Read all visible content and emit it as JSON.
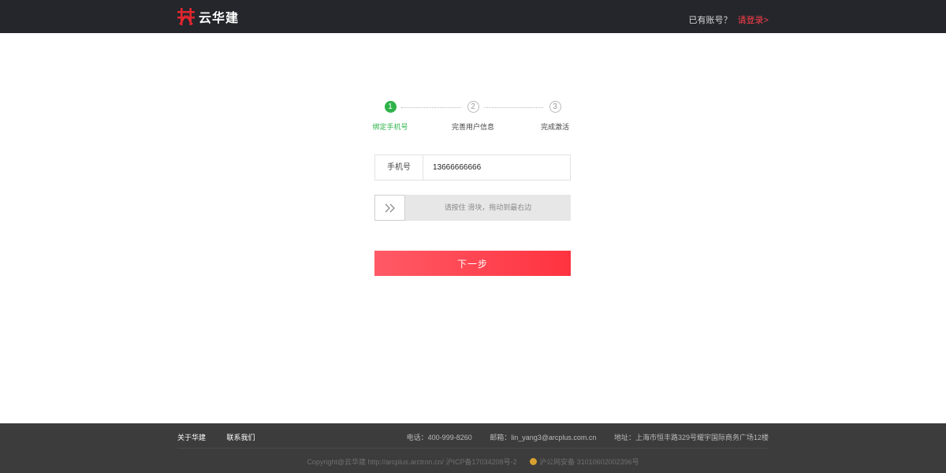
{
  "header": {
    "brand_name": "云华建",
    "logo_color": "#e0262f",
    "account_prompt": "已有账号？",
    "login_link": "请登录>"
  },
  "steps": [
    {
      "number": "1",
      "label": "绑定手机号",
      "active": true
    },
    {
      "number": "2",
      "label": "完善用户信息",
      "active": false
    },
    {
      "number": "3",
      "label": "完成激活",
      "active": false
    }
  ],
  "form": {
    "phone_label": "手机号",
    "phone_value": "13666666666",
    "slider_hint": "请按住 滑块，拖动到最右边",
    "slider_icon": "double-chevron-right-icon",
    "next_button": "下一步"
  },
  "footer": {
    "links": [
      "关于华建",
      "联系我们"
    ],
    "phone": "电话：400-999-8260",
    "email": "邮箱：lin_yang3@arcplus.com.cn",
    "address": "地址：上海市恒丰路329号耀宇国际商务广场12楼",
    "copyright": "Copyright@云华建 http://arcplus.arctron.cn/ 沪ICP备17034208号-2",
    "police_record": "沪公网安备 31010602002396号"
  },
  "colors": {
    "topbar": "#24262b",
    "accent_red": "#ff3d4a",
    "step_active": "#2fb34a",
    "footer": "#3c3c3c"
  }
}
